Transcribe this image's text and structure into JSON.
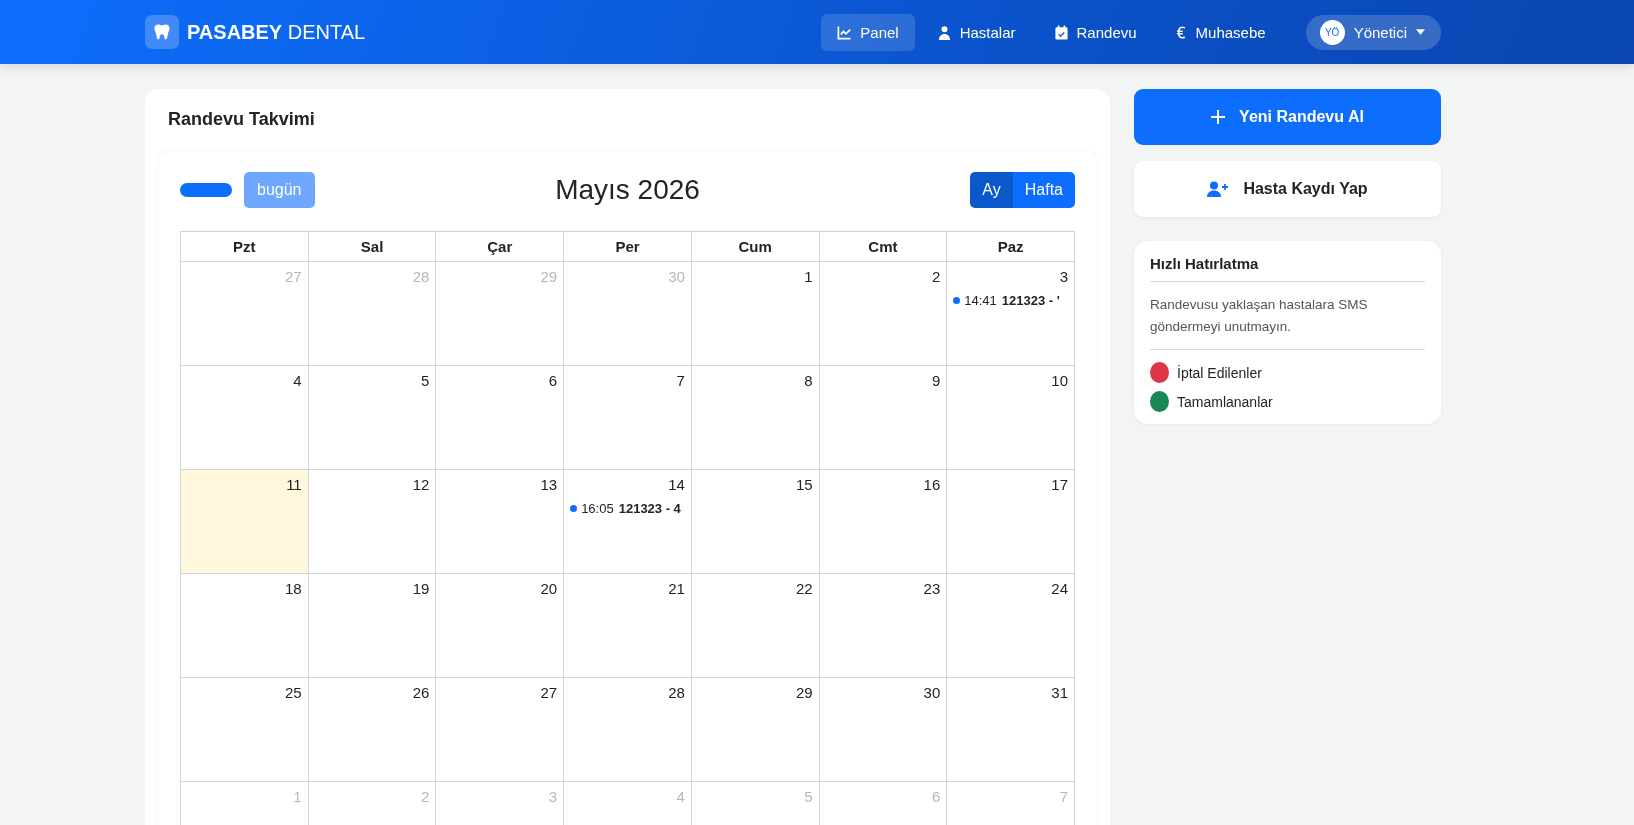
{
  "brand": {
    "bold": "PASABEY",
    "rest": "DENTAL"
  },
  "nav": [
    {
      "label": "Panel",
      "selected": true
    },
    {
      "label": "Hastalar",
      "selected": false
    },
    {
      "label": "Randevu",
      "selected": false
    },
    {
      "label": "Muhasebe",
      "selected": false
    }
  ],
  "user": {
    "initials": "YÖ",
    "name": "Yönetici"
  },
  "calendar": {
    "title": "Randevu Takvimi",
    "today_button": "bugün",
    "month": "Mayıs 2026",
    "views": [
      {
        "label": "Ay",
        "selected": true
      },
      {
        "label": "Hafta",
        "selected": false
      }
    ],
    "weekdays": [
      "Pzt",
      "Sal",
      "Çar",
      "Per",
      "Cum",
      "Cmt",
      "Paz"
    ],
    "weeks": [
      [
        {
          "day": "27",
          "other_month": true,
          "today": false
        },
        {
          "day": "28",
          "other_month": true,
          "today": false
        },
        {
          "day": "29",
          "other_month": true,
          "today": false
        },
        {
          "day": "30",
          "other_month": true,
          "today": false
        },
        {
          "day": "1",
          "other_month": false,
          "today": false
        },
        {
          "day": "2",
          "other_month": false,
          "today": false
        },
        {
          "day": "3",
          "other_month": false,
          "today": false,
          "events": [
            {
              "time": "14:41",
              "title": "121323 - '"
            }
          ]
        }
      ],
      [
        {
          "day": "4",
          "other_month": false,
          "today": false
        },
        {
          "day": "5",
          "other_month": false,
          "today": false
        },
        {
          "day": "6",
          "other_month": false,
          "today": false
        },
        {
          "day": "7",
          "other_month": false,
          "today": false
        },
        {
          "day": "8",
          "other_month": false,
          "today": false
        },
        {
          "day": "9",
          "other_month": false,
          "today": false
        },
        {
          "day": "10",
          "other_month": false,
          "today": false
        }
      ],
      [
        {
          "day": "11",
          "other_month": false,
          "today": true
        },
        {
          "day": "12",
          "other_month": false,
          "today": false
        },
        {
          "day": "13",
          "other_month": false,
          "today": false
        },
        {
          "day": "14",
          "other_month": false,
          "today": false,
          "events": [
            {
              "time": "16:05",
              "title": "121323 - 4"
            }
          ]
        },
        {
          "day": "15",
          "other_month": false,
          "today": false
        },
        {
          "day": "16",
          "other_month": false,
          "today": false
        },
        {
          "day": "17",
          "other_month": false,
          "today": false
        }
      ],
      [
        {
          "day": "18",
          "other_month": false,
          "today": false
        },
        {
          "day": "19",
          "other_month": false,
          "today": false
        },
        {
          "day": "20",
          "other_month": false,
          "today": false
        },
        {
          "day": "21",
          "other_month": false,
          "today": false
        },
        {
          "day": "22",
          "other_month": false,
          "today": false
        },
        {
          "day": "23",
          "other_month": false,
          "today": false
        },
        {
          "day": "24",
          "other_month": false,
          "today": false
        }
      ],
      [
        {
          "day": "25",
          "other_month": false,
          "today": false
        },
        {
          "day": "26",
          "other_month": false,
          "today": false
        },
        {
          "day": "27",
          "other_month": false,
          "today": false
        },
        {
          "day": "28",
          "other_month": false,
          "today": false
        },
        {
          "day": "29",
          "other_month": false,
          "today": false
        },
        {
          "day": "30",
          "other_month": false,
          "today": false
        },
        {
          "day": "31",
          "other_month": false,
          "today": false
        }
      ],
      [
        {
          "day": "1",
          "other_month": true,
          "today": false
        },
        {
          "day": "2",
          "other_month": true,
          "today": false
        },
        {
          "day": "3",
          "other_month": true,
          "today": false
        },
        {
          "day": "4",
          "other_month": true,
          "today": false
        },
        {
          "day": "5",
          "other_month": true,
          "today": false
        },
        {
          "day": "6",
          "other_month": true,
          "today": false
        },
        {
          "day": "7",
          "other_month": true,
          "today": false
        }
      ]
    ]
  },
  "actions": {
    "new_appointment": "Yeni Randevu Al",
    "register_patient": "Hasta Kaydı Yap"
  },
  "reminder": {
    "title": "Hızlı Hatırlatma",
    "text": "Randevusu yaklaşan hastalara SMS göndermeyi unutmayın.",
    "legend": [
      {
        "label": "İptal Edilenler",
        "color": "#dc3545"
      },
      {
        "label": "Tamamlananlar",
        "color": "#198754"
      }
    ]
  }
}
